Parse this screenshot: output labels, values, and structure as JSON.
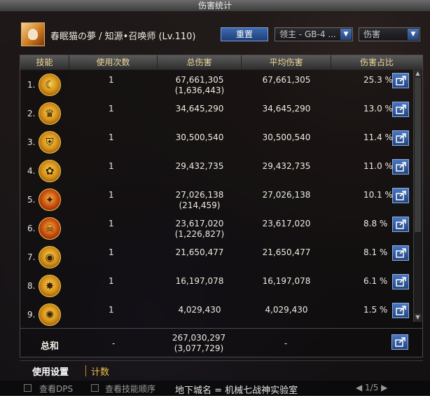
{
  "window": {
    "title": "伤害统计"
  },
  "header": {
    "character_name": "春眠猫の夢 / 知源•召唤师 (Lv.110)",
    "reset_label": "重置",
    "dungeon_select": "领主 - GB-4 ...",
    "metric_select": "伤害"
  },
  "table": {
    "columns": [
      "技能",
      "使用次数",
      "总伤害",
      "平均伤害",
      "伤害占比"
    ],
    "rows": [
      {
        "rank": "1.",
        "icon": "crescent-slash-icon",
        "count": "1",
        "total": "67,661,305",
        "total_sub": "(1,636,443)",
        "avg": "67,661,305",
        "pct": "25.3 %"
      },
      {
        "rank": "2.",
        "icon": "crown-icon",
        "count": "1",
        "total": "34,645,290",
        "total_sub": "",
        "avg": "34,645,290",
        "pct": "13.0 %"
      },
      {
        "rank": "3.",
        "icon": "shield-icon",
        "count": "1",
        "total": "30,500,540",
        "total_sub": "",
        "avg": "30,500,540",
        "pct": "11.4 %"
      },
      {
        "rank": "4.",
        "icon": "flower-icon",
        "count": "1",
        "total": "29,432,735",
        "total_sub": "",
        "avg": "29,432,735",
        "pct": "11.0 %"
      },
      {
        "rank": "5.",
        "icon": "flame-sword-icon",
        "count": "1",
        "total": "27,026,138",
        "total_sub": "(214,459)",
        "avg": "27,026,138",
        "pct": "10.1 %"
      },
      {
        "rank": "6.",
        "icon": "demon-head-icon",
        "count": "1",
        "total": "23,617,020",
        "total_sub": "(1,226,827)",
        "avg": "23,617,020",
        "pct": "8.8 %"
      },
      {
        "rank": "7.",
        "icon": "eye-ring-icon",
        "count": "1",
        "total": "21,650,477",
        "total_sub": "",
        "avg": "21,650,477",
        "pct": "8.1 %"
      },
      {
        "rank": "8.",
        "icon": "dragon-claw-icon",
        "count": "1",
        "total": "16,197,078",
        "total_sub": "",
        "avg": "16,197,078",
        "pct": "6.1 %"
      },
      {
        "rank": "9.",
        "icon": "rune-circle-icon",
        "count": "1",
        "total": "4,029,430",
        "total_sub": "",
        "avg": "4,029,430",
        "pct": "1.5 %"
      }
    ],
    "totals": {
      "label": "总和",
      "count": "-",
      "total": "267,030,297",
      "total_sub": "(3,077,729)",
      "avg": "-"
    }
  },
  "tabs": [
    "使用设置",
    "计数"
  ],
  "bottom": {
    "check_dps": "查看DPS",
    "check_order": "查看技能顺序",
    "location": "地下城名 = 机械七战神实验室",
    "page": "1/5"
  },
  "colors": {
    "accent_blue": "#2d5aa0",
    "header_gold": "#f0d89a",
    "tab_orange": "#f0c24a"
  }
}
